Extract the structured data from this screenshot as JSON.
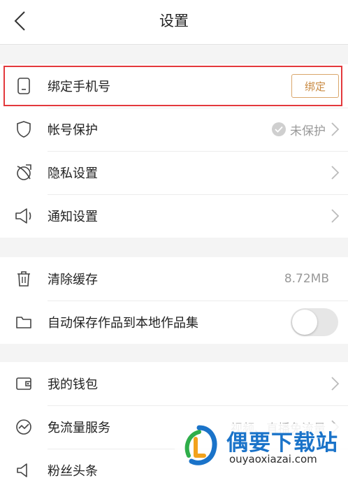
{
  "header": {
    "title": "设置"
  },
  "group1": [
    {
      "icon": "phone-icon",
      "label": "绑定手机号",
      "button": "绑定"
    },
    {
      "icon": "shield-icon",
      "label": "帐号保护",
      "value": "未保护"
    },
    {
      "icon": "privacy-icon",
      "label": "隐私设置"
    },
    {
      "icon": "speaker-icon",
      "label": "通知设置"
    }
  ],
  "group2": [
    {
      "icon": "trash-icon",
      "label": "清除缓存",
      "value": "8.72MB"
    },
    {
      "icon": "folder-icon",
      "label": "自动保存作品到本地作品集",
      "toggle": false
    }
  ],
  "group3": [
    {
      "icon": "wallet-icon",
      "label": "我的钱包"
    },
    {
      "icon": "traffic-icon",
      "label": "免流量服务",
      "value": "视频、直播免流量"
    },
    {
      "icon": "fans-icon",
      "label": "粉丝头条"
    }
  ],
  "watermark": {
    "title": "偶要下载站",
    "subtitle": "ouyaoxiazai.com"
  }
}
